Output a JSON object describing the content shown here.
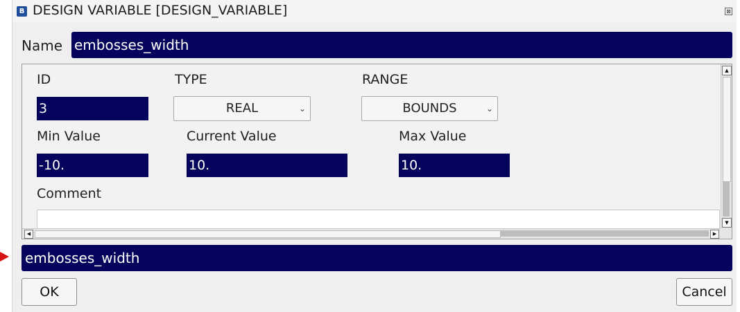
{
  "window": {
    "title": "DESIGN VARIABLE [DESIGN_VARIABLE]",
    "app_icon": "app-logo-icon",
    "close_glyph": "⊠"
  },
  "name": {
    "label": "Name",
    "value": "embosses_width"
  },
  "fields": {
    "id": {
      "label": "ID",
      "value": "3"
    },
    "type": {
      "label": "TYPE",
      "selected": "REAL"
    },
    "range": {
      "label": "RANGE",
      "selected": "BOUNDS"
    },
    "min": {
      "label": "Min Value",
      "value": "-10."
    },
    "current": {
      "label": "Current Value",
      "value": "10."
    },
    "max": {
      "label": "Max Value",
      "value": "10."
    },
    "comment": {
      "label": "Comment",
      "value": ""
    }
  },
  "status_line": {
    "value": "embosses_width"
  },
  "buttons": {
    "ok": "OK",
    "cancel": "Cancel"
  },
  "colors": {
    "field_bg": "#04045c",
    "field_text": "#ffffff",
    "dialog_bg": "#efefef",
    "pointer": "#d61414"
  }
}
